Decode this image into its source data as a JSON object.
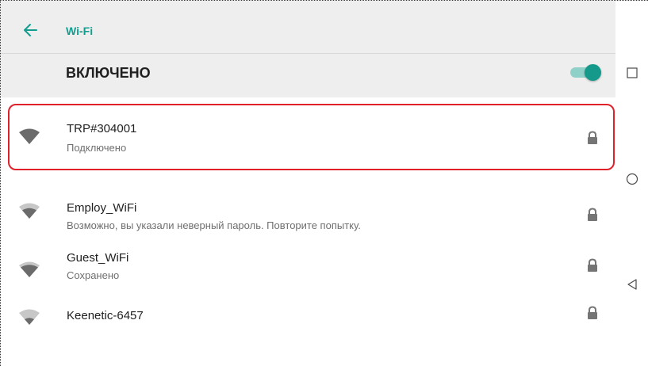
{
  "toolbar": {
    "title": "Wi-Fi",
    "accent_color": "#129e8f",
    "back_icon": "arrow-left-icon"
  },
  "master_switch": {
    "label": "ВКЛЮЧЕНО",
    "state": "on",
    "accent_color": "#14998a"
  },
  "networks": [
    {
      "name": "TRP#304001",
      "status": "Подключено",
      "signal_level": "full",
      "secured": true,
      "highlighted": true
    },
    {
      "name": "Employ_WiFi",
      "status": "Возможно, вы указали неверный пароль. Повторите попытку.",
      "signal_level": "partial",
      "secured": true
    },
    {
      "name": "Guest_WiFi",
      "status": "Сохранено",
      "signal_level": "partial",
      "secured": true
    },
    {
      "name": "Keenetic-6457",
      "status": "",
      "signal_level": "weak",
      "secured": true
    }
  ],
  "highlight_color": "#e0212c",
  "nav_bar": {
    "buttons": [
      "overview-square-icon",
      "home-circle-icon",
      "back-triangle-icon"
    ]
  }
}
